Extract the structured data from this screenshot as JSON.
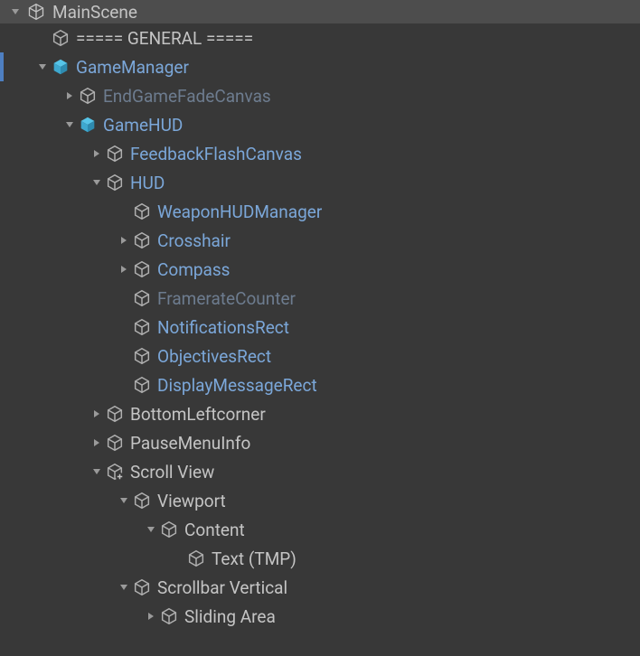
{
  "scene": {
    "name": "MainScene"
  },
  "items": [
    {
      "depth": 1,
      "toggle": "none",
      "icon": "gray",
      "label": "===== GENERAL =====",
      "style": "normal"
    },
    {
      "depth": 1,
      "toggle": "down",
      "icon": "blue",
      "label": "GameManager",
      "style": "prefab",
      "selected": true
    },
    {
      "depth": 2,
      "toggle": "right",
      "icon": "gray",
      "label": "EndGameFadeCanvas",
      "style": "disabled"
    },
    {
      "depth": 2,
      "toggle": "down",
      "icon": "blue",
      "label": "GameHUD",
      "style": "prefab"
    },
    {
      "depth": 3,
      "toggle": "right",
      "icon": "gray",
      "label": "FeedbackFlashCanvas",
      "style": "prefab"
    },
    {
      "depth": 3,
      "toggle": "down",
      "icon": "gray",
      "label": "HUD",
      "style": "prefab"
    },
    {
      "depth": 4,
      "toggle": "none",
      "icon": "gray",
      "label": "WeaponHUDManager",
      "style": "prefab"
    },
    {
      "depth": 4,
      "toggle": "right",
      "icon": "gray",
      "label": "Crosshair",
      "style": "prefab"
    },
    {
      "depth": 4,
      "toggle": "right",
      "icon": "gray",
      "label": "Compass",
      "style": "prefab"
    },
    {
      "depth": 4,
      "toggle": "none",
      "icon": "gray",
      "label": "FramerateCounter",
      "style": "disabled"
    },
    {
      "depth": 4,
      "toggle": "none",
      "icon": "gray",
      "label": "NotificationsRect",
      "style": "prefab"
    },
    {
      "depth": 4,
      "toggle": "none",
      "icon": "gray",
      "label": "ObjectivesRect",
      "style": "prefab"
    },
    {
      "depth": 4,
      "toggle": "none",
      "icon": "gray",
      "label": "DisplayMessageRect",
      "style": "prefab"
    },
    {
      "depth": 3,
      "toggle": "right",
      "icon": "gray",
      "label": "BottomLeftcorner",
      "style": "normal"
    },
    {
      "depth": 3,
      "toggle": "right",
      "icon": "gray",
      "label": "PauseMenuInfo",
      "style": "normal"
    },
    {
      "depth": 3,
      "toggle": "down",
      "icon": "gray",
      "label": "Scroll View",
      "style": "normal",
      "overlay": "plus"
    },
    {
      "depth": 4,
      "toggle": "down",
      "icon": "gray",
      "label": "Viewport",
      "style": "normal"
    },
    {
      "depth": 5,
      "toggle": "down",
      "icon": "gray",
      "label": "Content",
      "style": "normal"
    },
    {
      "depth": 6,
      "toggle": "none",
      "icon": "gray",
      "label": "Text (TMP)",
      "style": "normal"
    },
    {
      "depth": 4,
      "toggle": "down",
      "icon": "gray",
      "label": "Scrollbar Vertical",
      "style": "normal"
    },
    {
      "depth": 5,
      "toggle": "right",
      "icon": "gray",
      "label": "Sliding Area",
      "style": "normal"
    }
  ]
}
